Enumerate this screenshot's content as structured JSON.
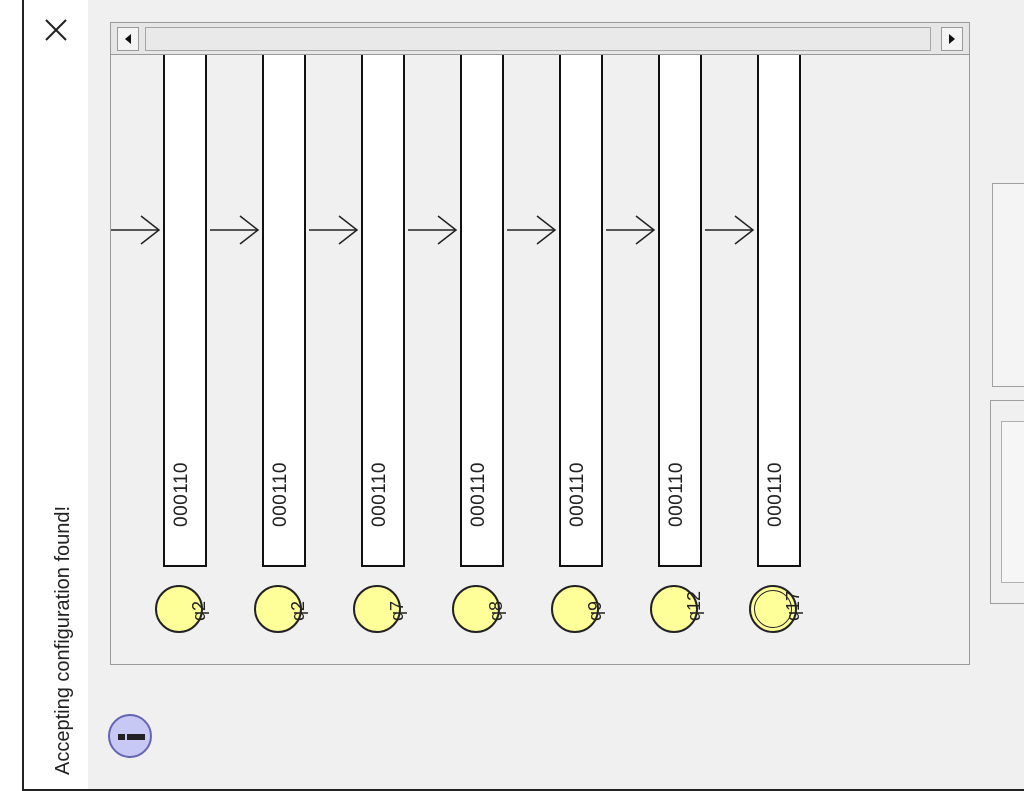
{
  "window": {
    "title": "Accepting configuration found!",
    "close_icon": "close-icon"
  },
  "configurations": [
    {
      "state": "q2",
      "tape": "000110",
      "final": false
    },
    {
      "state": "q2",
      "tape": "000110",
      "final": false
    },
    {
      "state": "q7",
      "tape": "000110",
      "final": false
    },
    {
      "state": "q8",
      "tape": "000110",
      "final": false
    },
    {
      "state": "q9",
      "tape": "000110",
      "final": false
    },
    {
      "state": "q12",
      "tape": "000110",
      "final": false
    },
    {
      "state": "q17",
      "tape": "000110",
      "final": true
    }
  ],
  "icons": {
    "info": "info-icon",
    "scroll_left": "arrow-left-icon",
    "scroll_right": "arrow-right-icon",
    "transition": "arrow-icon"
  },
  "colors": {
    "state_fill": "#ffff99",
    "info_fill": "#c8c8f4"
  }
}
